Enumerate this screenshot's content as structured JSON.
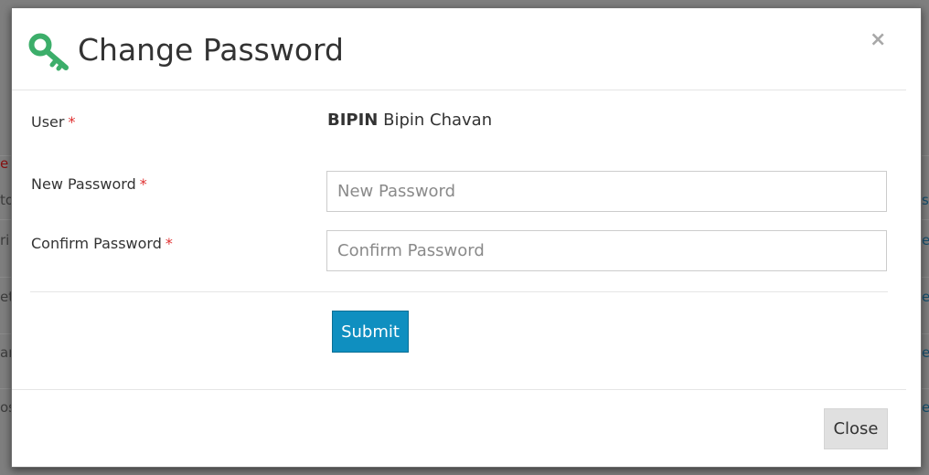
{
  "background": {
    "left_fragments": [
      "e",
      "to",
      "ri",
      "et",
      "ar",
      "os"
    ],
    "right_fragments": [
      "s",
      "e",
      "e",
      "e",
      "e"
    ]
  },
  "modal": {
    "title": "Change Password",
    "icon": "key-icon",
    "close_glyph": "×",
    "accent_color": "#3cae6a",
    "form": {
      "user_label": "User",
      "required_marker": "*",
      "user_code": "BIPIN",
      "user_name": "Bipin Chavan",
      "new_password_label": "New Password",
      "new_password_placeholder": "New Password",
      "new_password_value": "",
      "confirm_password_label": "Confirm Password",
      "confirm_password_placeholder": "Confirm Password",
      "confirm_password_value": "",
      "submit_label": "Submit",
      "submit_color": "#0f8fc0"
    },
    "footer": {
      "close_label": "Close"
    }
  }
}
